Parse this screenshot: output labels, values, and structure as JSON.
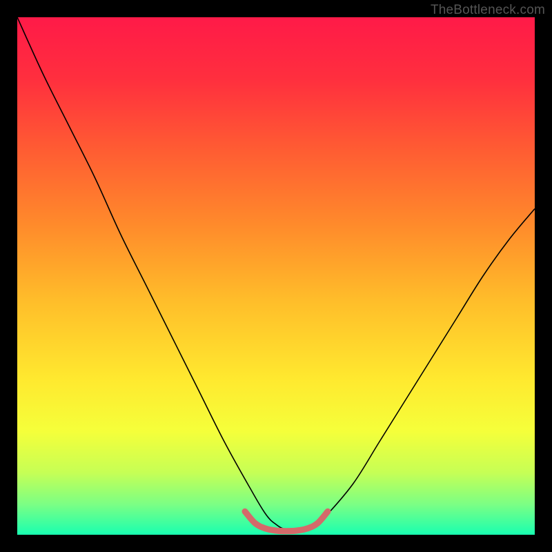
{
  "watermark": "TheBottleneck.com",
  "chart_data": {
    "type": "line",
    "title": "",
    "xlabel": "",
    "ylabel": "",
    "xlim": [
      0,
      100
    ],
    "ylim": [
      0,
      100
    ],
    "grid": false,
    "legend": false,
    "background_gradient": {
      "stops": [
        {
          "offset": 0.0,
          "color": "#ff1a48"
        },
        {
          "offset": 0.12,
          "color": "#ff2f3e"
        },
        {
          "offset": 0.25,
          "color": "#ff5a33"
        },
        {
          "offset": 0.4,
          "color": "#ff8a2b"
        },
        {
          "offset": 0.55,
          "color": "#ffbe2a"
        },
        {
          "offset": 0.7,
          "color": "#ffe92f"
        },
        {
          "offset": 0.8,
          "color": "#f5ff3a"
        },
        {
          "offset": 0.88,
          "color": "#c6ff55"
        },
        {
          "offset": 0.94,
          "color": "#7dff83"
        },
        {
          "offset": 1.0,
          "color": "#19ffb0"
        }
      ]
    },
    "series": [
      {
        "name": "bottleneck-curve",
        "color": "#000000",
        "stroke_width": 1.6,
        "x": [
          0,
          5,
          10,
          15,
          20,
          25,
          30,
          35,
          40,
          45,
          48,
          50,
          52,
          55,
          58,
          60,
          65,
          70,
          75,
          80,
          85,
          90,
          95,
          100
        ],
        "y": [
          100,
          89,
          79,
          69,
          58,
          48,
          38,
          28,
          18,
          9,
          4,
          2,
          1,
          1,
          2,
          4,
          10,
          18,
          26,
          34,
          42,
          50,
          57,
          63
        ]
      },
      {
        "name": "floor-highlight",
        "color": "#d46a6a",
        "stroke_width": 9,
        "linecap": "round",
        "x": [
          44,
          46,
          48,
          50,
          52,
          54,
          56,
          58,
          60
        ],
        "y": [
          4.5,
          2.2,
          1.2,
          0.8,
          0.7,
          0.8,
          1.2,
          2.2,
          4.5
        ]
      }
    ]
  }
}
